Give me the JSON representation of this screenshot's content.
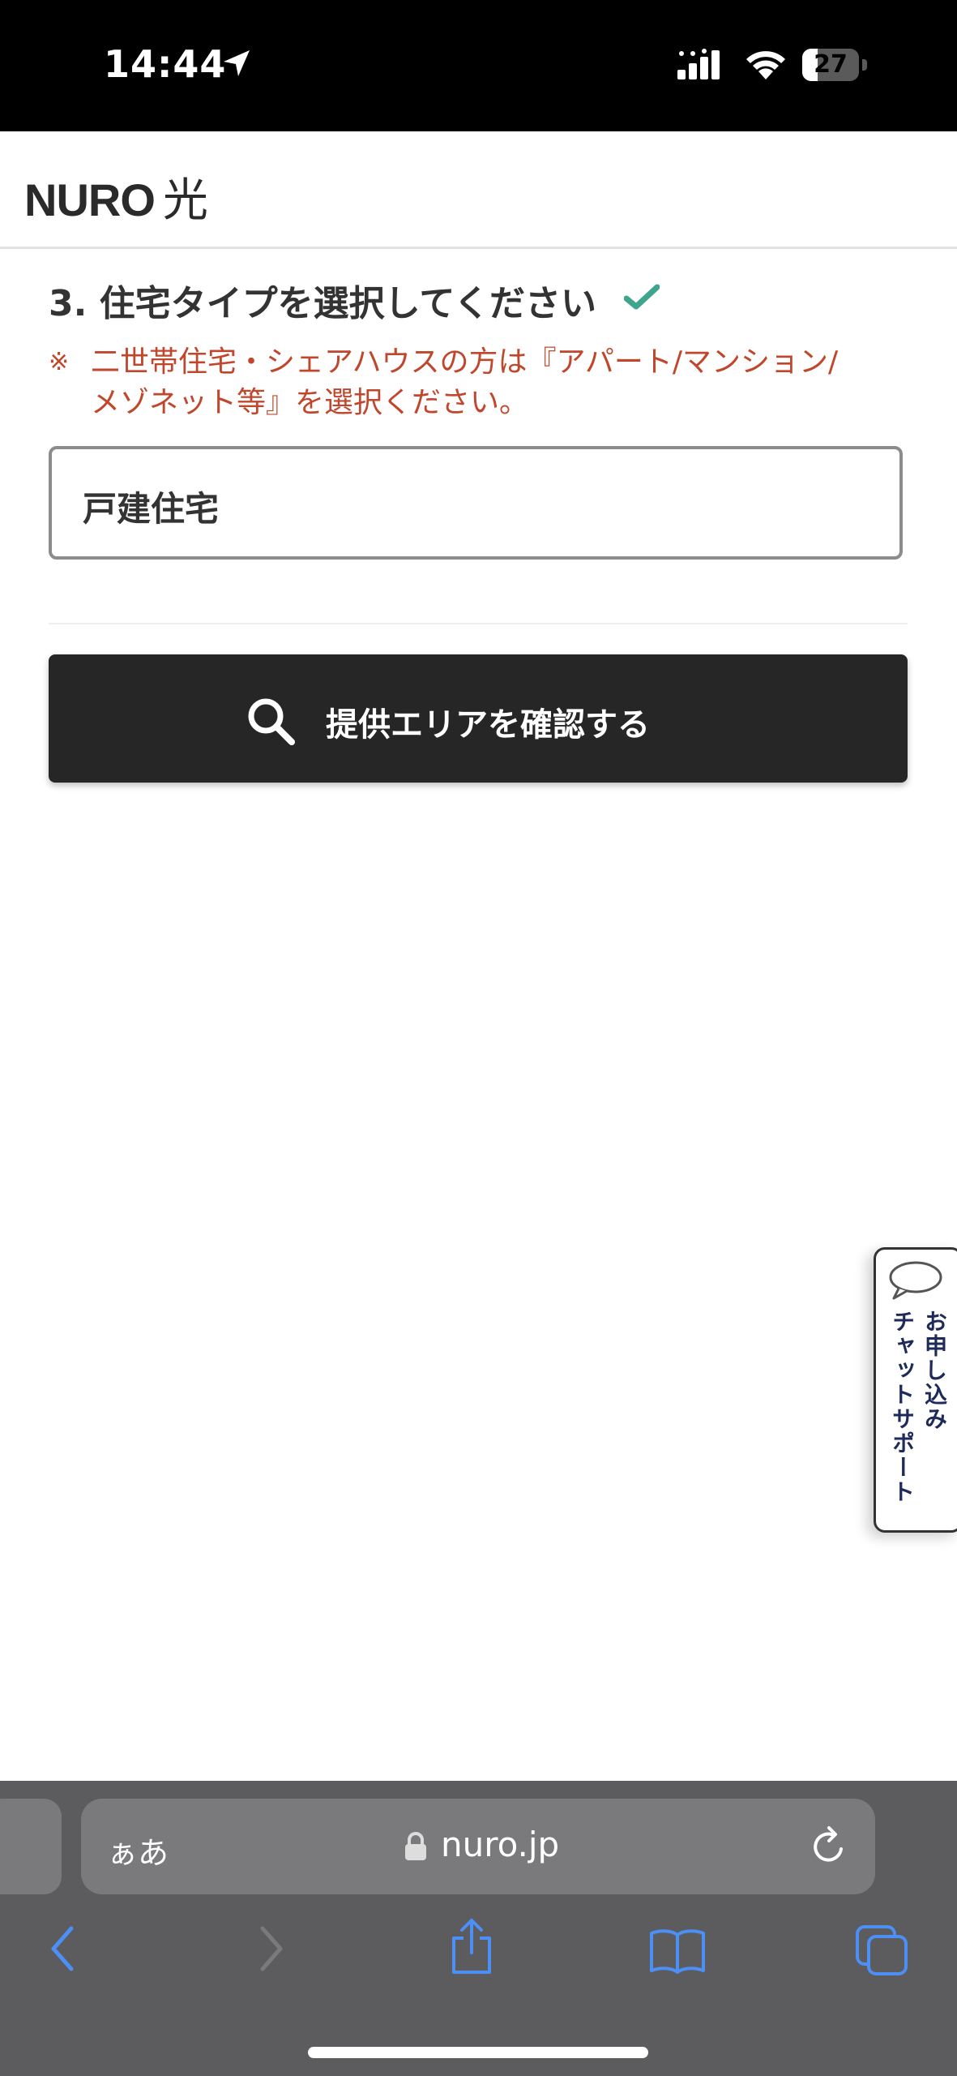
{
  "status_bar": {
    "time": "14:44",
    "battery_level": "27",
    "battery_fraction": 0.27
  },
  "header": {
    "logo_text": "NURO",
    "logo_suffix": "光"
  },
  "form": {
    "step_title": "3. 住宅タイプを選択してください",
    "note_mark": "※",
    "note_line1": "二世帯住宅・シェアハウスの方は『アパート/マンション/",
    "note_line2": "メゾネット等』を選択ください。",
    "housing_type_value": "戸建住宅",
    "search_button_label": "提供エリアを確認する"
  },
  "chat_tab": {
    "line1": "お申し込み",
    "line2": "チャットサポート"
  },
  "browser": {
    "aa_label": "ぁあ",
    "domain": "nuro.jp"
  },
  "colors": {
    "note_red": "#c0472b",
    "check_green": "#3fa58d",
    "button_dark": "#262626",
    "safari_blue": "#4c8ff5"
  },
  "icons": [
    "location-arrow-icon",
    "signal-icon",
    "wifi-icon",
    "checkmark-icon",
    "search-icon",
    "chat-bubble-icon",
    "lock-icon",
    "reload-icon",
    "back-icon",
    "forward-icon",
    "share-icon",
    "bookmarks-icon",
    "tabs-icon"
  ]
}
